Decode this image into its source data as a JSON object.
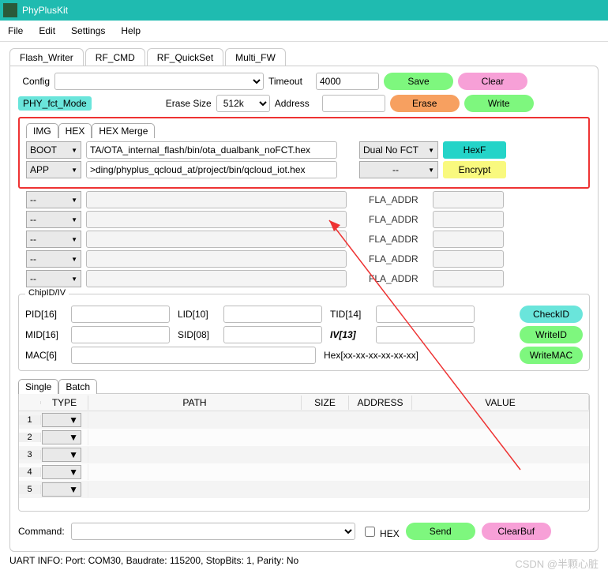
{
  "window": {
    "title": "PhyPlusKit"
  },
  "menu": {
    "file": "File",
    "edit": "Edit",
    "settings": "Settings",
    "help": "Help"
  },
  "tabs": [
    "Flash_Writer",
    "RF_CMD",
    "RF_QuickSet",
    "Multi_FW"
  ],
  "config": {
    "label": "Config",
    "value": ""
  },
  "timeout": {
    "label": "Timeout",
    "value": "4000"
  },
  "phy_mode": "PHY_fct_Mode",
  "erase_size": {
    "label": "Erase Size",
    "value": "512k"
  },
  "address": {
    "label": "Address",
    "value": ""
  },
  "buttons": {
    "save": "Save",
    "clear": "Clear",
    "erase": "Erase",
    "write": "Write",
    "hexf": "HexF",
    "encrypt": "Encrypt",
    "checkid": "CheckID",
    "writeid": "WriteID",
    "writemac": "WriteMAC",
    "send": "Send",
    "clearbuf": "ClearBuf"
  },
  "inner_tabs": [
    "IMG",
    "HEX",
    "HEX Merge"
  ],
  "merge_rows": [
    {
      "type": "BOOT",
      "path": "TA/OTA_internal_flash/bin/ota_dualbank_noFCT.hex",
      "opt": "Dual No FCT"
    },
    {
      "type": "APP",
      "path": ">ding/phyplus_qcloud_at/project/bin/qcloud_iot.hex",
      "opt": "--"
    },
    {
      "type": "--",
      "path": "",
      "opt": "",
      "rlabel": "FLA_ADDR"
    },
    {
      "type": "--",
      "path": "",
      "opt": "",
      "rlabel": "FLA_ADDR"
    },
    {
      "type": "--",
      "path": "",
      "opt": "",
      "rlabel": "FLA_ADDR"
    },
    {
      "type": "--",
      "path": "",
      "opt": "",
      "rlabel": "FLA_ADDR"
    },
    {
      "type": "--",
      "path": "",
      "opt": "",
      "rlabel": "FLA_ADDR"
    }
  ],
  "chipid": {
    "legend": "ChipID/IV",
    "pid": "PID[16]",
    "lid": "LID[10]",
    "tid": "TID[14]",
    "mid": "MID[16]",
    "sid": "SID[08]",
    "iv": "IV[13]",
    "mac": "MAC[6]",
    "hex_label": "Hex[xx-xx-xx-xx-xx-xx]"
  },
  "single_batch": [
    "Single",
    "Batch"
  ],
  "grid_headers": {
    "idx": "",
    "type": "TYPE",
    "path": "PATH",
    "size": "SIZE",
    "addr": "ADDRESS",
    "value": "VALUE"
  },
  "grid_rows": [
    "1",
    "2",
    "3",
    "4",
    "5"
  ],
  "command": {
    "label": "Command:",
    "value": "",
    "hex": "HEX"
  },
  "uart": "UART INFO: Port: COM30, Baudrate: 115200, StopBits: 1, Parity: No",
  "watermark": "CSDN @半颗心脏"
}
